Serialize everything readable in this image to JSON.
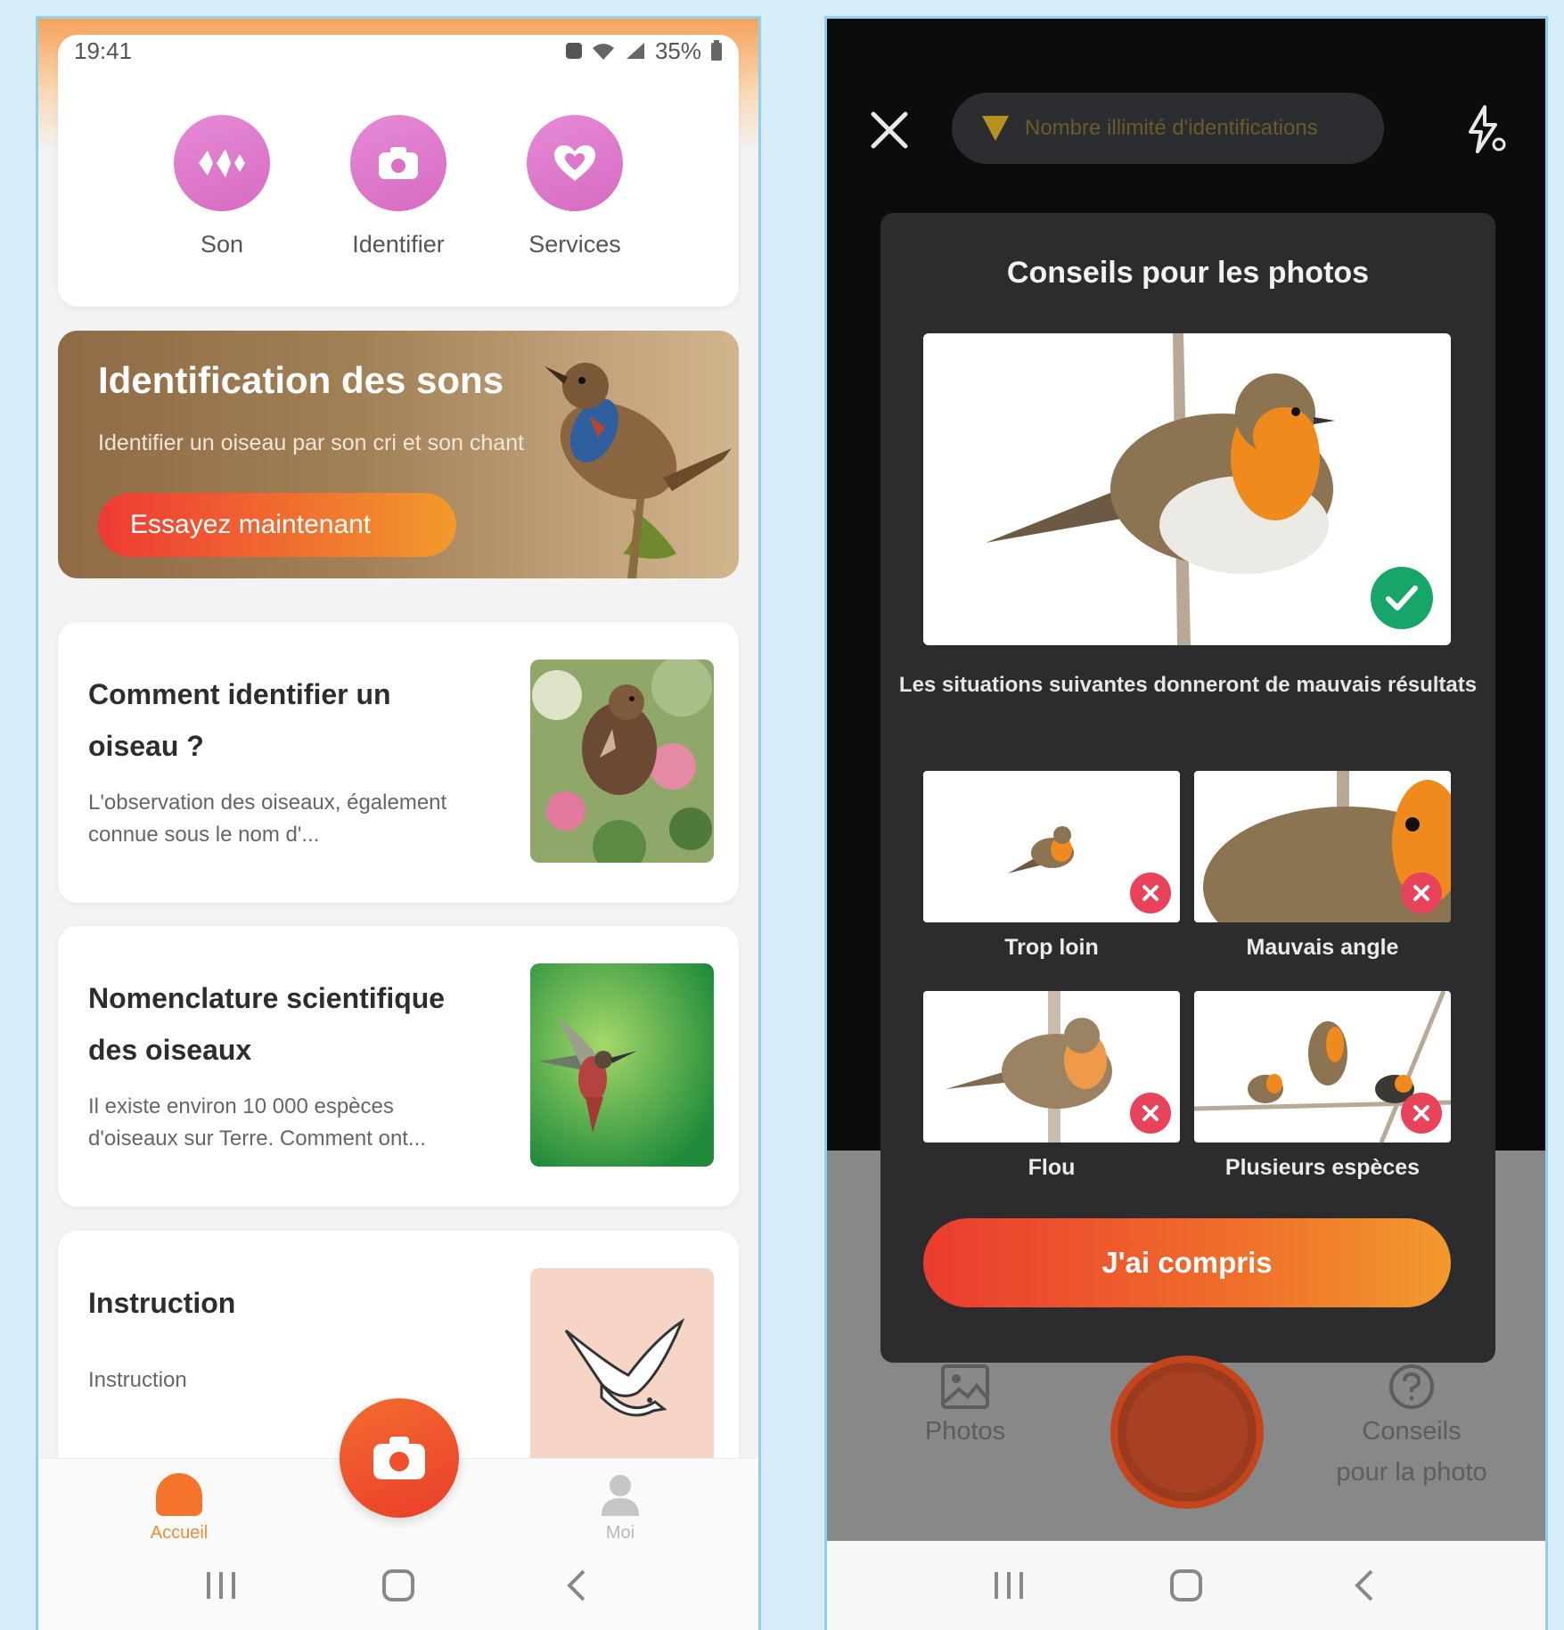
{
  "left_phone": {
    "status_bar": {
      "time": "19:41",
      "battery": "35%"
    },
    "quick_actions": [
      {
        "label": "Son",
        "icon": "sound-wave-icon"
      },
      {
        "label": "Identifier",
        "icon": "camera-icon"
      },
      {
        "label": "Services",
        "icon": "heart-icon"
      }
    ],
    "banner": {
      "title": "Identification des sons",
      "subtitle": "Identifier un oiseau par son cri et son chant",
      "button": "Essayez maintenant"
    },
    "articles": [
      {
        "title": "Comment identifier un oiseau ?",
        "description": "L'observation des oiseaux, également connue sous le nom d'..."
      },
      {
        "title": "Nomenclature scientifique des oiseaux",
        "description": "Il existe environ 10 000 espèces d'oiseaux sur Terre. Comment ont..."
      },
      {
        "title": "Instruction",
        "description": "Instruction"
      }
    ],
    "bottom_nav": {
      "home": "Accueil",
      "me": "Moi"
    },
    "colors": {
      "accent": "#f4742b",
      "quick_icon": "#dd77c9"
    }
  },
  "right_phone": {
    "pill_text": "Nombre illimité d'identifications",
    "modal": {
      "title": "Conseils pour les photos",
      "note": "Les situations suivantes donneront de mauvais résultats",
      "bad_examples": [
        "Trop loin",
        "Mauvais angle",
        "Flou",
        "Plusieurs espèces"
      ],
      "button": "J'ai compris"
    },
    "camera_controls": {
      "photos": "Photos",
      "tips_line1": "Conseils",
      "tips_line2": "pour la photo"
    },
    "colors": {
      "good": "#17a66a",
      "bad": "#e8435a",
      "button": "#ea3b2f"
    }
  }
}
